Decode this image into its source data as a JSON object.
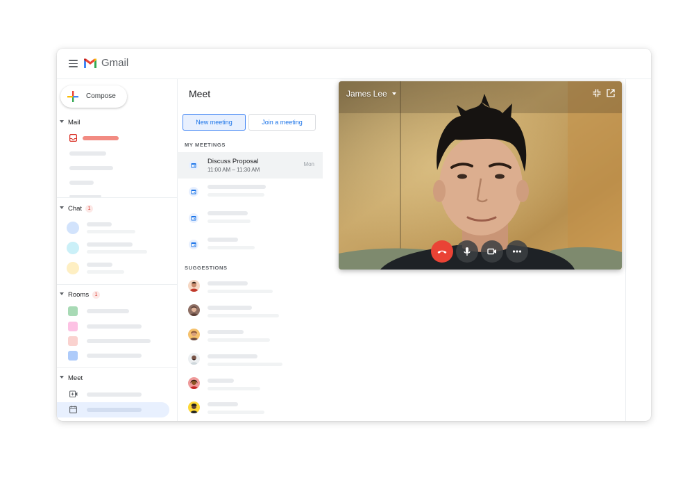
{
  "app": {
    "title": "Gmail"
  },
  "sidebar": {
    "compose_label": "Compose",
    "sections": {
      "mail": {
        "label": "Mail"
      },
      "chat": {
        "label": "Chat",
        "badge": "1"
      },
      "rooms": {
        "label": "Rooms",
        "badge": "1"
      },
      "meet": {
        "label": "Meet"
      }
    }
  },
  "meet": {
    "title": "Meet",
    "new_meeting_label": "New meeting",
    "join_meeting_label": "Join a meeting",
    "my_meetings_heading": "MY MEETINGS",
    "suggestions_heading": "SUGGESTIONS",
    "meetings": [
      {
        "title": "Discuss Proposal",
        "time": "11:00 AM – 11:30 AM",
        "day": "Mon"
      }
    ]
  },
  "video": {
    "caller_name": "James Lee",
    "controls": [
      "end-call-icon",
      "microphone-icon",
      "camera-icon",
      "more-icon"
    ]
  },
  "colors": {
    "accent": "#1a73e8",
    "end_call": "#ea4335",
    "placeholder": "#e8eaed"
  }
}
